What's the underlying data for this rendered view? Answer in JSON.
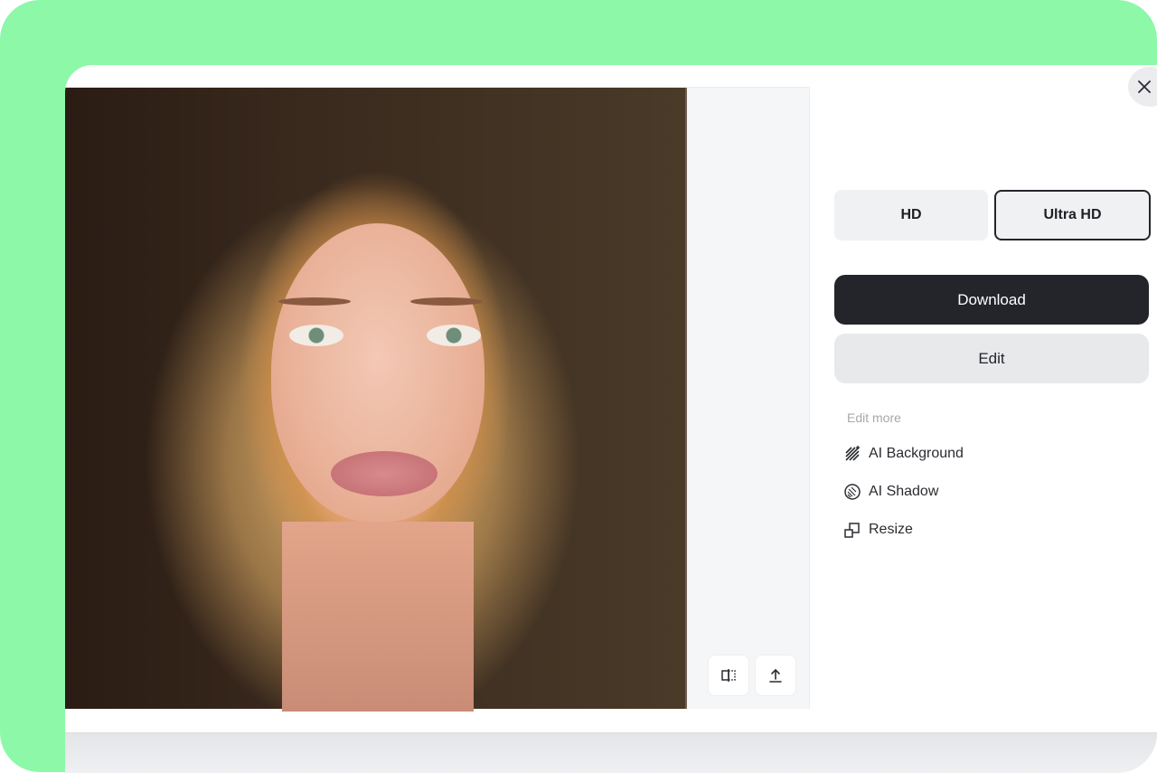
{
  "modal": {
    "close_icon": "close-icon",
    "image_alt": "Portrait of a woman with wavy strawberry-blonde hair in braids",
    "preview_tools": [
      {
        "name": "compare",
        "icon": "compare-split-icon"
      },
      {
        "name": "upload",
        "icon": "upload-icon"
      }
    ]
  },
  "side_panel": {
    "quality_options": [
      {
        "label": "HD",
        "selected": false
      },
      {
        "label": "Ultra HD",
        "selected": true
      }
    ],
    "download_label": "Download",
    "edit_label": "Edit",
    "edit_more_label": "Edit more",
    "edit_more_items": [
      {
        "label": "AI Background",
        "icon": "ai-background-icon"
      },
      {
        "label": "AI Shadow",
        "icon": "ai-shadow-icon"
      },
      {
        "label": "Resize",
        "icon": "resize-icon"
      }
    ]
  },
  "colors": {
    "frame_green": "#8cf8a8",
    "primary_dark": "#23252b",
    "secondary_gray": "#e8e9eb"
  }
}
